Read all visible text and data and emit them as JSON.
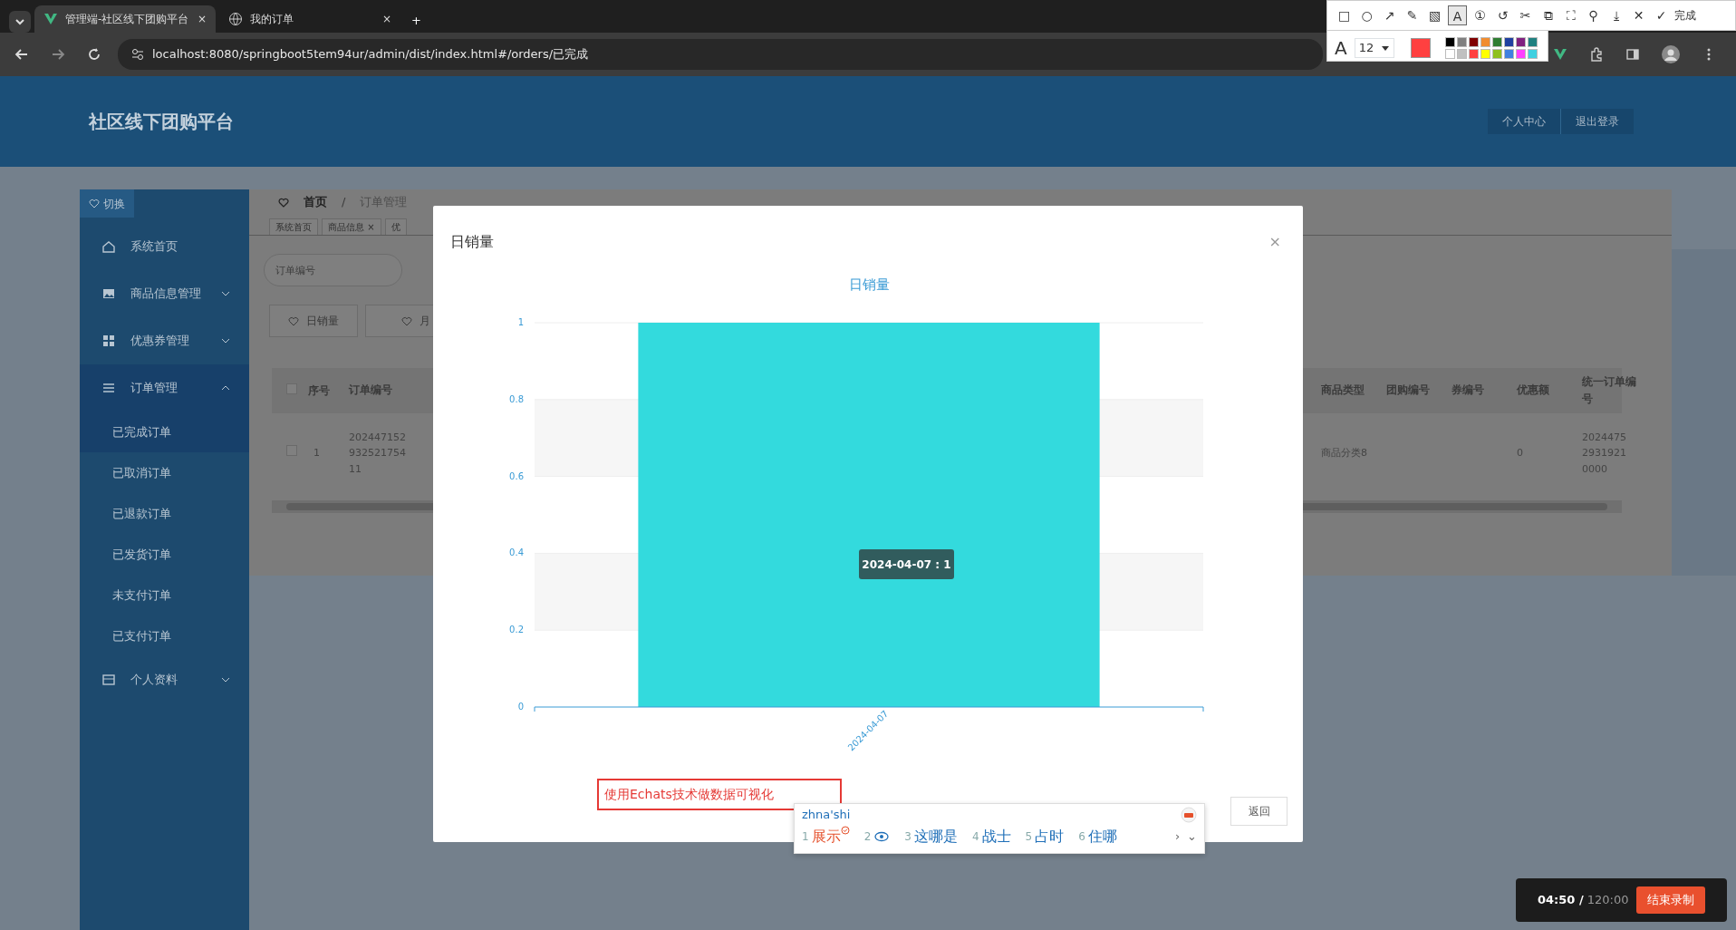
{
  "browser": {
    "tabs": [
      {
        "title": "管理端-社区线下团购平台",
        "selected": true,
        "close": "×"
      },
      {
        "title": "我的订单",
        "selected": false,
        "close": "×"
      }
    ],
    "new_tab": "+",
    "address": "localhost:8080/springboot5tem94ur/admin/dist/index.html#/orders/已完成"
  },
  "annotation_toolbar": {
    "tools": [
      {
        "symbol": "□",
        "selected": false
      },
      {
        "symbol": "○",
        "selected": false
      },
      {
        "symbol": "↗",
        "selected": false
      },
      {
        "symbol": "✎",
        "selected": false
      },
      {
        "symbol": "▧",
        "selected": false
      },
      {
        "symbol": "A",
        "selected": true
      },
      {
        "symbol": "①",
        "selected": false
      },
      {
        "symbol": "↺",
        "selected": false
      },
      {
        "symbol": "✂",
        "selected": false
      },
      {
        "symbol": "⧉",
        "selected": false
      },
      {
        "symbol": "⛶",
        "selected": false
      },
      {
        "symbol": "⚲",
        "selected": false
      },
      {
        "symbol": "⤓",
        "selected": false
      },
      {
        "symbol": "✕",
        "selected": false
      },
      {
        "symbol": "✓",
        "selected": false
      }
    ],
    "done": "完成",
    "font_label": "A",
    "font_size": "12",
    "current": {
      "color": "#ff4040"
    },
    "palette": [
      {
        "color": "#000000"
      },
      {
        "color": "#808080"
      },
      {
        "color": "#800000"
      },
      {
        "color": "#f08c30"
      },
      {
        "color": "#2f7d32"
      },
      {
        "color": "#2040a0"
      },
      {
        "color": "#802080"
      },
      {
        "color": "#208080"
      },
      {
        "color": "#ffffff"
      },
      {
        "color": "#c0c0c0"
      },
      {
        "color": "#ff4040"
      },
      {
        "color": "#ffff00"
      },
      {
        "color": "#90c020"
      },
      {
        "color": "#4080e0"
      },
      {
        "color": "#ff40ff"
      },
      {
        "color": "#40d0e0"
      }
    ]
  },
  "header": {
    "title": "社区线下团购平台",
    "buttons": [
      "个人中心",
      "退出登录"
    ]
  },
  "sidebar": {
    "toggle": "切换",
    "items": [
      {
        "kind": "link",
        "label": "系统首页"
      },
      {
        "kind": "group",
        "label": "商品信息管理",
        "expanded": false
      },
      {
        "kind": "group",
        "label": "优惠券管理",
        "expanded": false
      },
      {
        "kind": "group",
        "label": "订单管理",
        "expanded": true,
        "children": [
          {
            "label": "已完成订单",
            "selected": true
          },
          {
            "label": "已取消订单",
            "selected": false
          },
          {
            "label": "已退款订单",
            "selected": false
          },
          {
            "label": "已发货订单",
            "selected": false
          },
          {
            "label": "未支付订单",
            "selected": false
          },
          {
            "label": "已支付订单",
            "selected": false
          }
        ]
      },
      {
        "kind": "group",
        "label": "个人资料",
        "expanded": false
      }
    ]
  },
  "breadcrumb": [
    "首页",
    "订单管理"
  ],
  "breadcrumb_separator": "/",
  "open_tabs": [
    {
      "label": "系统首页"
    },
    {
      "label": "商品信息",
      "close_mark": "×"
    },
    {
      "label": "优"
    }
  ],
  "search": {
    "placeholder": "订单编号"
  },
  "actions": [
    "日销量",
    "月"
  ],
  "table": {
    "all_checked": false,
    "columns": [
      "序号",
      "订单编号",
      "商品类型",
      "团购编号",
      "券编号",
      "优惠额",
      "统一订单编号"
    ],
    "rows": [
      {
        "checked": false,
        "no": "1",
        "order_no": "20244715293252175411",
        "category": "商品分类8",
        "discount": "0",
        "unified_no": "202447529319210000"
      }
    ]
  },
  "modal": {
    "title": "日销量",
    "close": "×",
    "chart_data": {
      "type": "bar",
      "title": "日销量",
      "grid": true,
      "categories": [
        "2024-04-07"
      ],
      "values": [
        1
      ],
      "ylim": [
        0,
        1
      ],
      "yticks": [
        0,
        0.2,
        0.4,
        0.6,
        0.8,
        1
      ]
    },
    "tooltip": "2024-04-07 : 1",
    "back_button": "返回"
  },
  "annotation_box": {
    "text": "使用Echats技术做数据可视化"
  },
  "ime": {
    "input": "zhna'shi",
    "candidates": [
      {
        "kind": "word",
        "index": "1",
        "text": "展示",
        "selected": true
      },
      {
        "kind": "icon",
        "index": "2",
        "selected": false
      },
      {
        "kind": "word",
        "index": "3",
        "text": "这哪是",
        "selected": false
      },
      {
        "kind": "word",
        "index": "4",
        "text": "战士",
        "selected": false
      },
      {
        "kind": "word",
        "index": "5",
        "text": "占时",
        "selected": false
      },
      {
        "kind": "word",
        "index": "6",
        "text": "住哪",
        "selected": false
      }
    ],
    "next": "›",
    "expand": "⌄"
  },
  "recording": {
    "elapsed": "04:50",
    "separator": "/",
    "total": "120:00",
    "stop_button": "结束录制"
  }
}
